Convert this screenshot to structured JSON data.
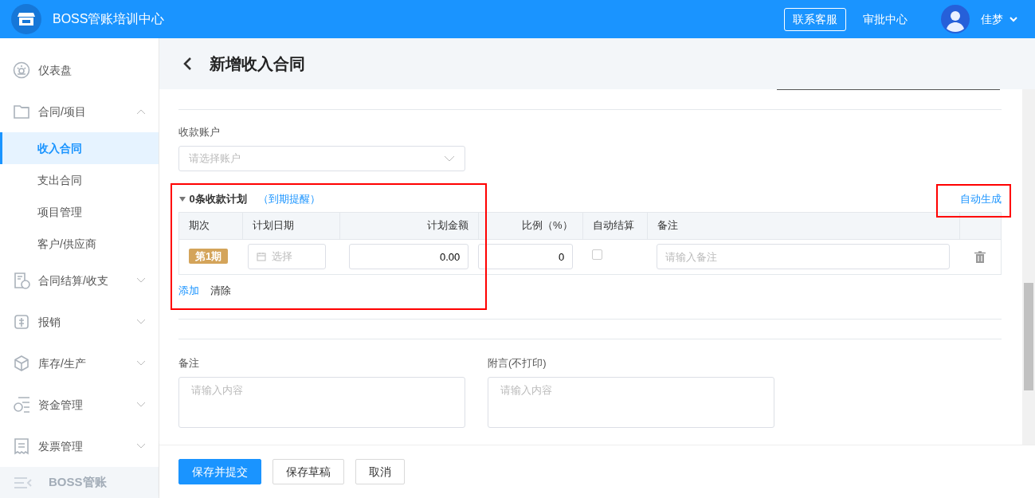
{
  "app": {
    "title": "BOSS管账培训中心"
  },
  "header": {
    "support_button": "联系客服",
    "approval_link": "审批中心",
    "user_name": "佳梦"
  },
  "sidebar": {
    "items": [
      {
        "label": "仪表盘",
        "selected": false
      },
      {
        "label": "合同/项目",
        "selected": false,
        "expanded": true,
        "children": [
          {
            "label": "收入合同",
            "selected": true
          },
          {
            "label": "支出合同",
            "selected": false
          },
          {
            "label": "项目管理",
            "selected": false
          },
          {
            "label": "客户/供应商",
            "selected": false
          }
        ]
      },
      {
        "label": "合同结算/收支",
        "selected": false,
        "expanded": false
      },
      {
        "label": "报销",
        "selected": false,
        "expanded": false
      },
      {
        "label": "库存/生产",
        "selected": false,
        "expanded": false
      },
      {
        "label": "资金管理",
        "selected": false,
        "expanded": false
      },
      {
        "label": "发票管理",
        "selected": false,
        "expanded": false
      }
    ],
    "collapse_label": "BOSS管账"
  },
  "page": {
    "title": "新增收入合同"
  },
  "form": {
    "account": {
      "label": "收款账户",
      "placeholder": "请选择账户"
    },
    "plan": {
      "title": "0条收款计划",
      "reminder_link": "（到期提醒）",
      "expanded": true,
      "highlighted": true,
      "auto_generate": {
        "label": "自动生成",
        "highlighted": true
      },
      "columns": [
        "期次",
        "计划日期",
        "计划金额",
        "比例（%）",
        "自动结算",
        "备注"
      ],
      "rows": [
        {
          "period": "第1期",
          "date_placeholder": "选择",
          "amount": "0.00",
          "ratio": "0",
          "auto_settle": false,
          "note_placeholder": "请输入备注"
        }
      ],
      "add_link": "添加",
      "clear_link": "清除"
    },
    "notes": [
      {
        "label": "备注",
        "placeholder": "请输入内容"
      },
      {
        "label": "附言(不打印)",
        "placeholder": "请输入内容"
      }
    ]
  },
  "footer": {
    "buttons": [
      {
        "label": "保存并提交",
        "kind": "primary"
      },
      {
        "label": "保存草稿",
        "kind": "default"
      },
      {
        "label": "取消",
        "kind": "default"
      }
    ]
  }
}
